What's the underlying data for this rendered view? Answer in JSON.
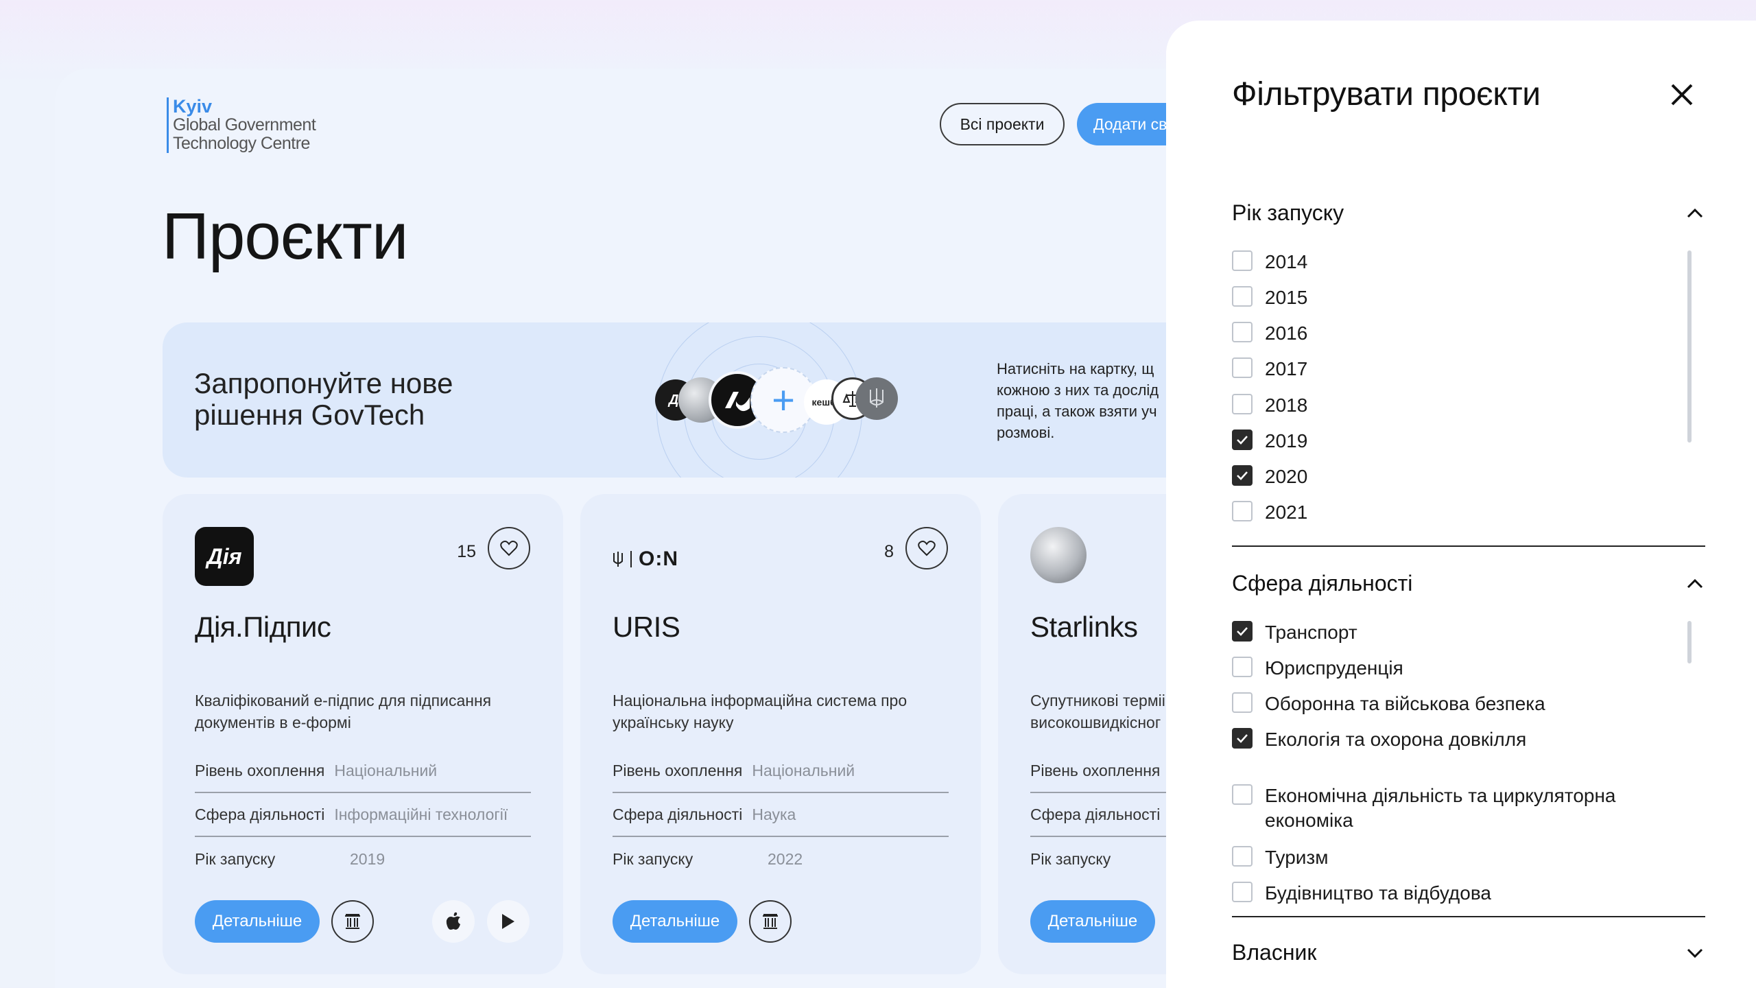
{
  "brand": {
    "city": "Kyiv",
    "line1": "Global Government",
    "line2": "Technology Centre",
    "accent": "#3a8be8"
  },
  "header": {
    "all_projects_label": "Всі проекти",
    "add_label": "Додати св"
  },
  "page_title": "Проєкти",
  "banner": {
    "title_line1": "Запропонуйте нове",
    "title_line2": "рішення GovTech",
    "text_lines": [
      "Натисніть на картку, щ",
      "кожною з них та дослід",
      "праці, а також взяти уч",
      "розмові."
    ],
    "icons": [
      "dia-avatar",
      "starlink-avatar",
      "ua-logo-avatar",
      "plus-icon",
      "cashback-avatar",
      "trident-avatar"
    ]
  },
  "cards": [
    {
      "logo": "Дія",
      "likes": "15",
      "title": "Дія.Підпис",
      "desc_line1": "Кваліфікований е-підпис для підписання",
      "desc_line2": "документів в е-формі",
      "level_label": "Рівень охоплення",
      "level_value": "Національний",
      "sphere_label": "Сфера діяльності",
      "sphere_value": "Інформаційні технології",
      "year_label": "Рік запуску",
      "year_value": "2019",
      "more_label": "Детальніше",
      "icons": [
        "museum-icon",
        "apple-icon",
        "play-store-icon"
      ]
    },
    {
      "logo": "O:N",
      "likes": "8",
      "title": "URIS",
      "desc_line1": "Національна інформаційна система про",
      "desc_line2": "українську науку",
      "level_label": "Рівень охоплення",
      "level_value": "Національний",
      "sphere_label": "Сфера діяльності",
      "sphere_value": "Наука",
      "year_label": "Рік запуску",
      "year_value": "2022",
      "more_label": "Детальніше",
      "icons": [
        "museum-icon"
      ]
    },
    {
      "logo": "starlink-dish",
      "title": "Starlinks",
      "desc_line1": "Супутникові терміі",
      "desc_line2": "високошвидкісног",
      "level_label": "Рівень охоплення",
      "sphere_label": "Сфера діяльності",
      "year_label": "Рік запуску",
      "more_label": "Детальніше"
    }
  ],
  "filter": {
    "title": "Фільтрувати проєкти",
    "close_icon": "close-icon",
    "sections": [
      {
        "title": "Рік запуску",
        "expanded": true,
        "options": [
          {
            "label": "2014",
            "checked": false
          },
          {
            "label": "2015",
            "checked": false
          },
          {
            "label": "2016",
            "checked": false
          },
          {
            "label": "2017",
            "checked": false
          },
          {
            "label": "2018",
            "checked": false
          },
          {
            "label": "2019",
            "checked": true
          },
          {
            "label": "2020",
            "checked": true
          },
          {
            "label": "2021",
            "checked": false
          }
        ]
      },
      {
        "title": "Сфера діяльності",
        "expanded": true,
        "options": [
          {
            "label": "Транспорт",
            "checked": true
          },
          {
            "label": "Юриспруденція",
            "checked": false
          },
          {
            "label": "Оборонна та військова безпека",
            "checked": false
          },
          {
            "label": "Екологія та охорона довкілля",
            "checked": true
          },
          {
            "label": "Економічна діяльність та циркуляторна",
            "label2": "економіка",
            "checked": false
          },
          {
            "label": "Туризм",
            "checked": false
          },
          {
            "label": "Будівництво та відбудова",
            "checked": false
          }
        ]
      },
      {
        "title": "Власник",
        "expanded": false
      }
    ]
  },
  "colors": {
    "primary": "#4a9cf2",
    "checked": "#2b2b2b"
  }
}
